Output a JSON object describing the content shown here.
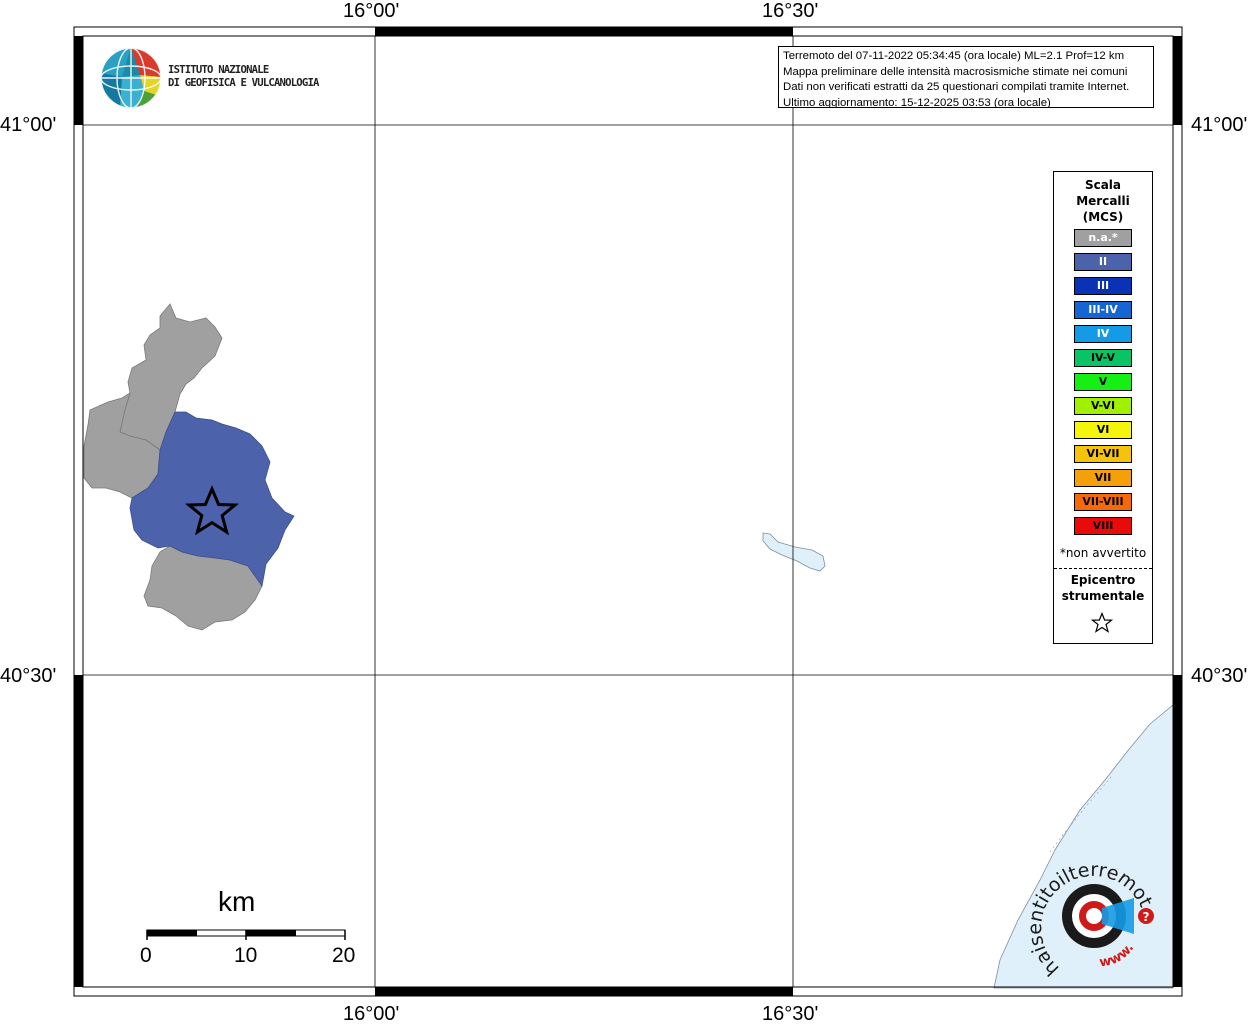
{
  "map": {
    "frame": {
      "lon_range": [
        "15°39'",
        "16°52'"
      ],
      "lat_range": [
        "40°12'",
        "41°05'"
      ]
    },
    "lon_labels_top": [
      "16°00'",
      "16°30'"
    ],
    "lon_labels_bottom": [
      "16°00'",
      "16°30'"
    ],
    "lat_labels_left": [
      "41°00'",
      "40°30'"
    ],
    "lat_labels_right": [
      "41°00'",
      "40°30'"
    ],
    "colors": {
      "na": "#a0a0a0",
      "II": "#4c62ab",
      "sea": "#dff0fb",
      "frame": "#000000"
    }
  },
  "logo": {
    "line1": "ISTITUTO NAZIONALE",
    "line2": "DI GEOFISICA E VULCANOLOGIA",
    "icon": "ingv-globe-icon"
  },
  "info": {
    "line1": "Terremoto del 07-11-2022 05:34:45 (ora locale) ML=2.1 Prof=12 km",
    "line2": "Mappa preliminare delle intensità macrosismiche stimate nei comuni",
    "line3": "Dati non verificati estratti da 25 questionari compilati tramite Internet.",
    "line4": "Ultimo aggiornamento: 15-12-2025 03:53 (ora locale)"
  },
  "legend": {
    "title_line1": "Scala",
    "title_line2": "Mercalli",
    "title_line3": "(MCS)",
    "items": [
      {
        "label": "n.a.*",
        "color": "#a0a0a0",
        "text_color": "#ffffff"
      },
      {
        "label": "II",
        "color": "#4c62ab",
        "text_color": "#ffffff"
      },
      {
        "label": "III",
        "color": "#0a32b4",
        "text_color": "#ffffff"
      },
      {
        "label": "III-IV",
        "color": "#1565d2",
        "text_color": "#ffffff"
      },
      {
        "label": "IV",
        "color": "#159be6",
        "text_color": "#ffffff"
      },
      {
        "label": "IV-V",
        "color": "#0ac364",
        "text_color": "#000000"
      },
      {
        "label": "V",
        "color": "#14f014",
        "text_color": "#000000"
      },
      {
        "label": "V-VI",
        "color": "#a0f000",
        "text_color": "#000000"
      },
      {
        "label": "VI",
        "color": "#f5f50a",
        "text_color": "#000000"
      },
      {
        "label": "VI-VII",
        "color": "#f5c30a",
        "text_color": "#000000"
      },
      {
        "label": "VII",
        "color": "#f5a00a",
        "text_color": "#000000"
      },
      {
        "label": "VII-VIII",
        "color": "#f5690a",
        "text_color": "#000000"
      },
      {
        "label": "VIII",
        "color": "#eb0a0a",
        "text_color": "#000000"
      }
    ],
    "note": "*non avvertito",
    "epicenter_line1": "Epicentro",
    "epicenter_line2": "strumentale",
    "epicenter_icon": "star-icon"
  },
  "scale_bar": {
    "unit": "km",
    "ticks": [
      "0",
      "10",
      "20"
    ]
  },
  "watermark": {
    "text": "haisentitoilterremoto.it",
    "url_text": "www.",
    "question": "?",
    "icon": "hsit-target-icon"
  }
}
